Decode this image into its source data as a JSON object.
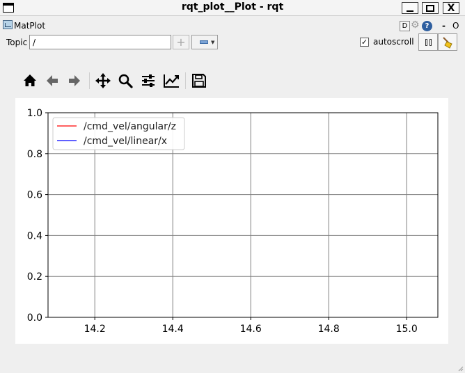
{
  "window": {
    "title": "rqt_plot__Plot - rqt",
    "buttons": {
      "minimize": "minimize",
      "maximize": "maximize",
      "close": "X"
    }
  },
  "plugin": {
    "title": "MatPlot",
    "debug_label": "D",
    "help_label": "?",
    "dash_label": "-",
    "close_label": "O"
  },
  "topic": {
    "label": "Topic",
    "value": "/",
    "add_label": "+",
    "autoscroll_label": "autoscroll",
    "autoscroll_checked": true,
    "check_mark": "✓"
  },
  "toolbar": {
    "icons": [
      "home-icon",
      "back-arrow-icon",
      "forward-arrow-icon",
      "pan-icon",
      "zoom-icon",
      "configure-subplots-icon",
      "edit-axis-icon",
      "save-icon"
    ]
  },
  "chart_data": {
    "type": "line",
    "xlim": [
      14.08,
      15.08
    ],
    "ylim": [
      0.0,
      1.0
    ],
    "xticks": [
      14.2,
      14.4,
      14.6,
      14.8,
      15.0
    ],
    "yticks": [
      0.0,
      0.2,
      0.4,
      0.6,
      0.8,
      1.0
    ],
    "xtick_labels": [
      "14.2",
      "14.4",
      "14.6",
      "14.8",
      "15.0"
    ],
    "ytick_labels": [
      "0.0",
      "0.2",
      "0.4",
      "0.6",
      "0.8",
      "1.0"
    ],
    "grid": true,
    "legend_position": "top-left",
    "series": [
      {
        "name": "/cmd_vel/angular/z",
        "color": "#ff0000",
        "x": [],
        "y": []
      },
      {
        "name": "/cmd_vel/linear/x",
        "color": "#0000ff",
        "x": [],
        "y": []
      }
    ]
  }
}
